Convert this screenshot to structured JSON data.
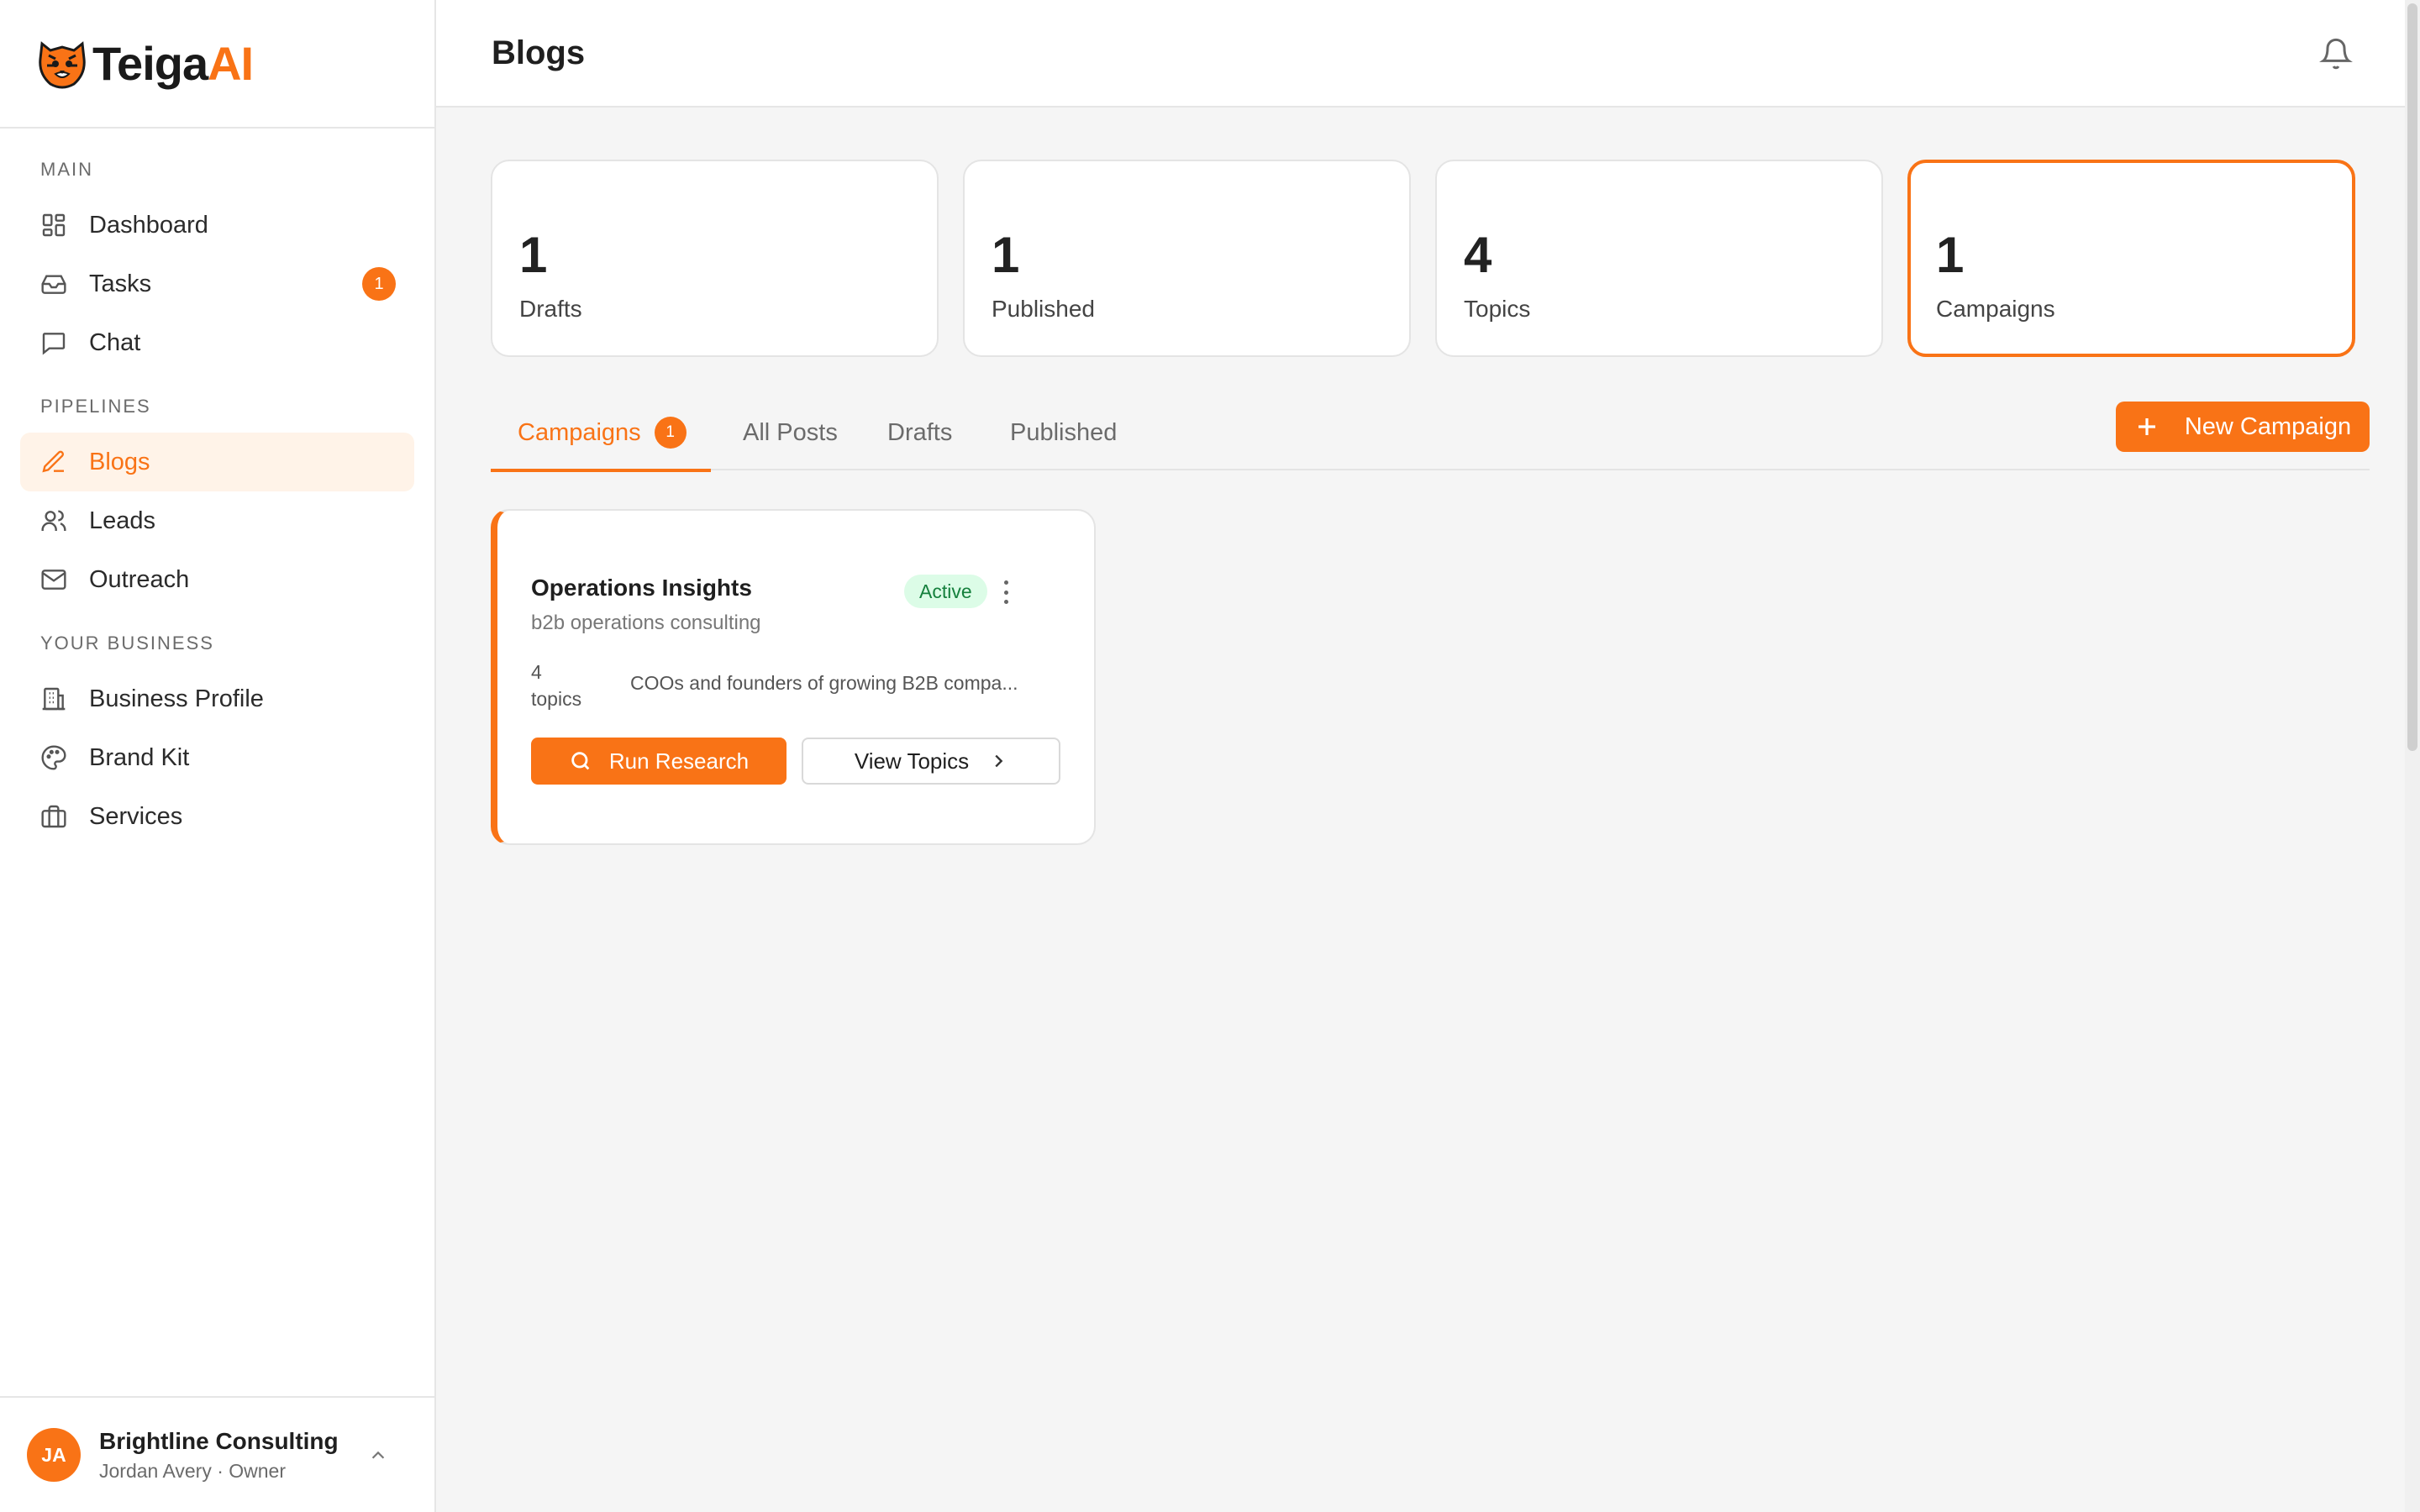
{
  "app": {
    "logo_primary": "Teiga",
    "logo_accent": "AI"
  },
  "sidebar": {
    "sections": [
      {
        "label": "MAIN"
      },
      {
        "label": "PIPELINES"
      },
      {
        "label": "YOUR BUSINESS"
      }
    ],
    "items": {
      "dashboard": {
        "label": "Dashboard",
        "icon": "dashboard-icon"
      },
      "tasks": {
        "label": "Tasks",
        "icon": "inbox-icon",
        "badge": "1"
      },
      "chat": {
        "label": "Chat",
        "icon": "chat-icon"
      },
      "blogs": {
        "label": "Blogs",
        "icon": "pen-icon"
      },
      "leads": {
        "label": "Leads",
        "icon": "users-icon"
      },
      "outreach": {
        "label": "Outreach",
        "icon": "mail-icon"
      },
      "business_profile": {
        "label": "Business Profile",
        "icon": "building-icon"
      },
      "brand_kit": {
        "label": "Brand Kit",
        "icon": "palette-icon"
      },
      "services": {
        "label": "Services",
        "icon": "briefcase-icon"
      }
    },
    "account": {
      "initials": "JA",
      "name": "Brightline Consulting",
      "subtitle": "Jordan Avery · Owner"
    }
  },
  "header": {
    "title": "Blogs"
  },
  "stats": [
    {
      "value": "1",
      "label": "Drafts"
    },
    {
      "value": "1",
      "label": "Published"
    },
    {
      "value": "4",
      "label": "Topics"
    },
    {
      "value": "1",
      "label": "Campaigns"
    }
  ],
  "tabs": [
    {
      "label": "Campaigns",
      "badge": "1"
    },
    {
      "label": "All Posts"
    },
    {
      "label": "Drafts"
    },
    {
      "label": "Published"
    }
  ],
  "actions": {
    "new_campaign": "New Campaign"
  },
  "campaign": {
    "title": "Operations Insights",
    "subtitle": "b2b operations consulting",
    "status": "Active",
    "topics_count": "4",
    "topics_word": "topics",
    "audience": "COOs and founders of growing B2B compa...",
    "run_label": "Run Research",
    "view_label": "View Topics"
  },
  "colors": {
    "accent": "#f97316",
    "active_bg": "#fff3e8",
    "status_bg": "#dcfce7",
    "status_text": "#15803d"
  }
}
